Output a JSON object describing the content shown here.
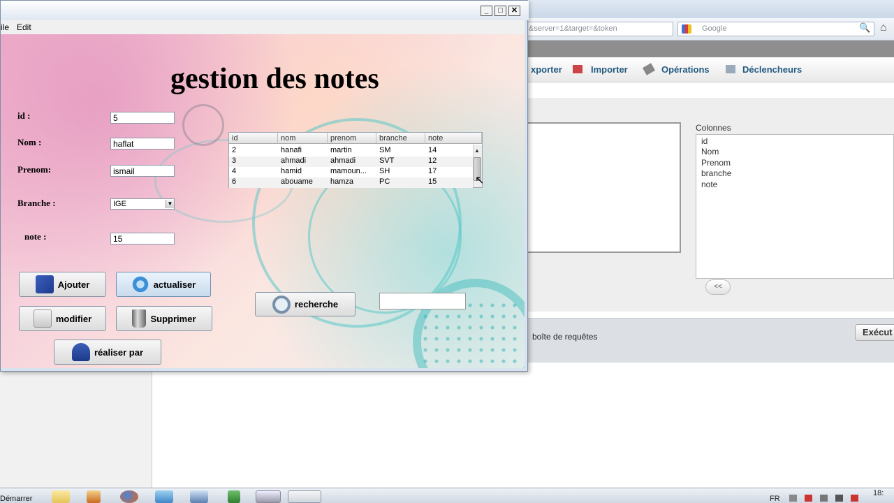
{
  "browser": {
    "url_fragment": "&server=1&target=&token",
    "search_placeholder": "Google",
    "tabs": [
      {
        "label": "xporter"
      },
      {
        "label": "Importer"
      },
      {
        "label": "Opérations"
      },
      {
        "label": "Déclencheurs"
      }
    ],
    "columns_label": "Colonnes",
    "columns": [
      "id",
      "Nom",
      "Prenom",
      "branche",
      "note"
    ],
    "shift_button": "<<",
    "bookmark_label": "boîte de requêtes",
    "execute_button": "Exécut"
  },
  "app": {
    "menu": [
      "ile",
      "Edit"
    ],
    "title": "gestion des notes",
    "form": {
      "id_label": "id :",
      "id_value": "5",
      "nom_label": "Nom :",
      "nom_value": "haflat",
      "prenom_label": "Prenom:",
      "prenom_value": "ismail",
      "branche_label": "Branche :",
      "branche_value": "IGE",
      "note_label": "note :",
      "note_value": "15"
    },
    "table": {
      "headers": [
        "id",
        "nom",
        "prenom",
        "branche",
        "note"
      ],
      "rows": [
        [
          "2",
          "hanafi",
          "martin",
          "SM",
          "14"
        ],
        [
          "3",
          "ahmadi",
          "ahmadi",
          "SVT",
          "12"
        ],
        [
          "4",
          "hamid",
          "mamoun...",
          "SH",
          "17"
        ],
        [
          "6",
          "abouame",
          "hamza",
          "PC",
          "15"
        ]
      ]
    },
    "buttons": {
      "ajouter": "Ajouter",
      "actualiser": "actualiser",
      "modifier": "modifier",
      "supprimer": "Supprimer",
      "recherche": "recherche",
      "realiser": "réaliser par"
    },
    "search_value": ""
  },
  "taskbar": {
    "start": "Démarrer",
    "lang": "FR",
    "clock": "18:"
  },
  "colors": {
    "pma_link": "#235a81",
    "swirl": "#5ac8c8"
  }
}
